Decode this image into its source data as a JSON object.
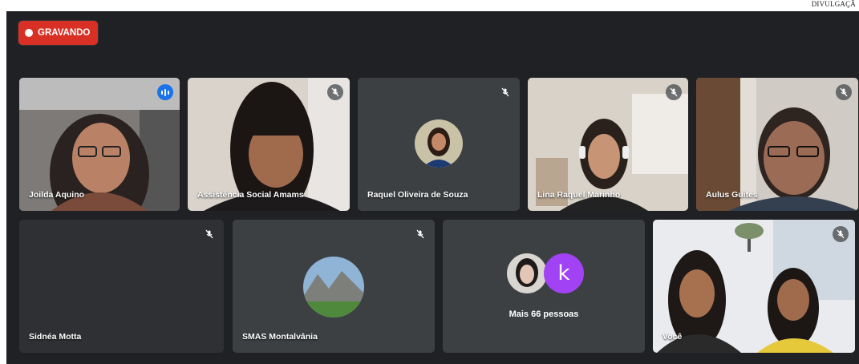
{
  "credit": "DIVULGAÇÃ",
  "recording": {
    "label": "GRAVANDO",
    "color": "#d93025"
  },
  "participants": [
    {
      "name": "Joilda Aquino",
      "icon": "speaking-icon",
      "active": true
    },
    {
      "name": "Assistência Social Amams",
      "icon": "mic-off-icon"
    },
    {
      "name": "Raquel Oliveira de Souza",
      "icon": "mic-off-icon"
    },
    {
      "name": "Lina Raquel Marinho",
      "icon": "mic-off-icon"
    },
    {
      "name": "Aulus Guites",
      "icon": "mic-off-icon"
    },
    {
      "name": "Sidnéa Motta",
      "icon": "mic-off-icon"
    },
    {
      "name": "SMAS Montalvânia",
      "icon": "mic-off-icon"
    },
    {
      "name": "Você",
      "icon": "mic-off-icon"
    }
  ],
  "more": {
    "label": "Mais 66 pessoas",
    "initial": "k",
    "initial_color": "#a142f4"
  }
}
